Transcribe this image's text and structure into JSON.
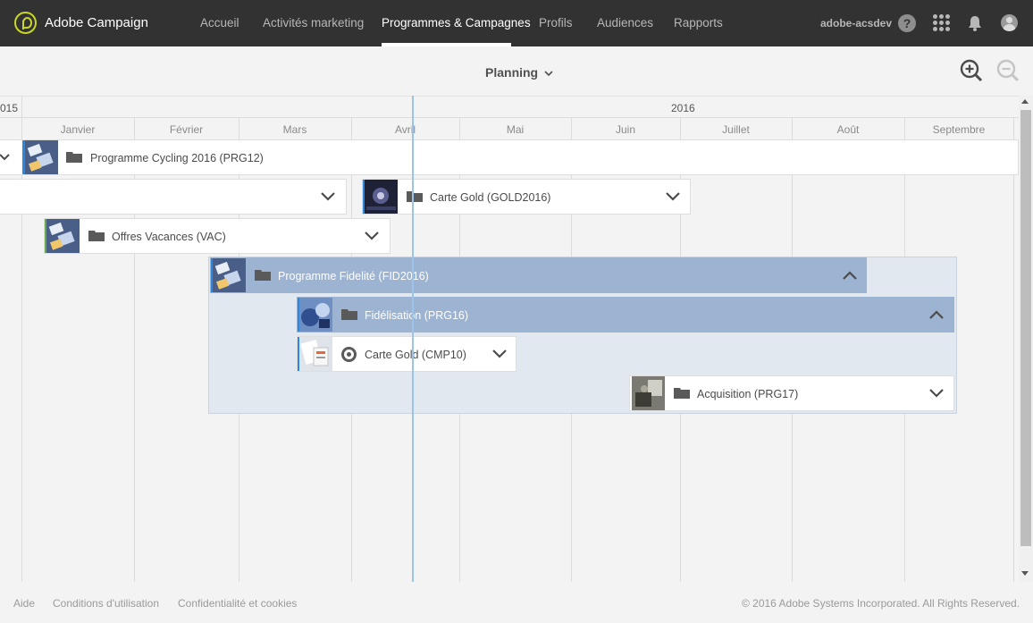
{
  "header": {
    "brand": "Adobe Campaign",
    "nav": [
      "Accueil",
      "Activités marketing",
      "Programmes & Campagnes",
      "Profils",
      "Audiences",
      "Rapports"
    ],
    "active_nav": "Programmes & Campagnes",
    "user": "adobe-acsdev",
    "help_glyph": "?"
  },
  "toolbar": {
    "view_label": "Planning",
    "icons": [
      "zoom-in-icon",
      "zoom-out-icon"
    ]
  },
  "timeline": {
    "years": [
      "015",
      "2016"
    ],
    "months": [
      "Janvier",
      "Février",
      "Mars",
      "Avril",
      "Mai",
      "Juin",
      "Juillet",
      "Août",
      "Septembre"
    ],
    "items": [
      {
        "label": "Programme Cycling 2016 (PRG12)",
        "icon": "folder-icon",
        "state": "collapsed"
      },
      {
        "label": "",
        "icon": "",
        "state": "collapsed"
      },
      {
        "label": "Carte Gold (GOLD2016)",
        "icon": "folder-icon",
        "state": "collapsed"
      },
      {
        "label": "Offres Vacances (VAC)",
        "icon": "folder-icon",
        "state": "collapsed"
      },
      {
        "label": "Programme Fidelité (FID2016)",
        "icon": "folder-icon",
        "state": "expanded"
      },
      {
        "label": "Fidélisation (PRG16)",
        "icon": "folder-icon",
        "state": "expanded"
      },
      {
        "label": "Carte Gold (CMP10)",
        "icon": "campaign-icon",
        "state": "collapsed"
      },
      {
        "label": "Acquisition (PRG17)",
        "icon": "folder-icon",
        "state": "collapsed"
      }
    ],
    "colors": {
      "selected": "#9cb3d2",
      "accent_blue": "#2d86d9",
      "accent_green": "#6aa84f",
      "today_line": "#9cc3ea"
    }
  },
  "footer": {
    "links": [
      "Aide",
      "Conditions d'utilisation",
      "Confidentialité et cookies"
    ],
    "copyright": "© 2016 Adobe Systems Incorporated. All Rights Reserved."
  }
}
